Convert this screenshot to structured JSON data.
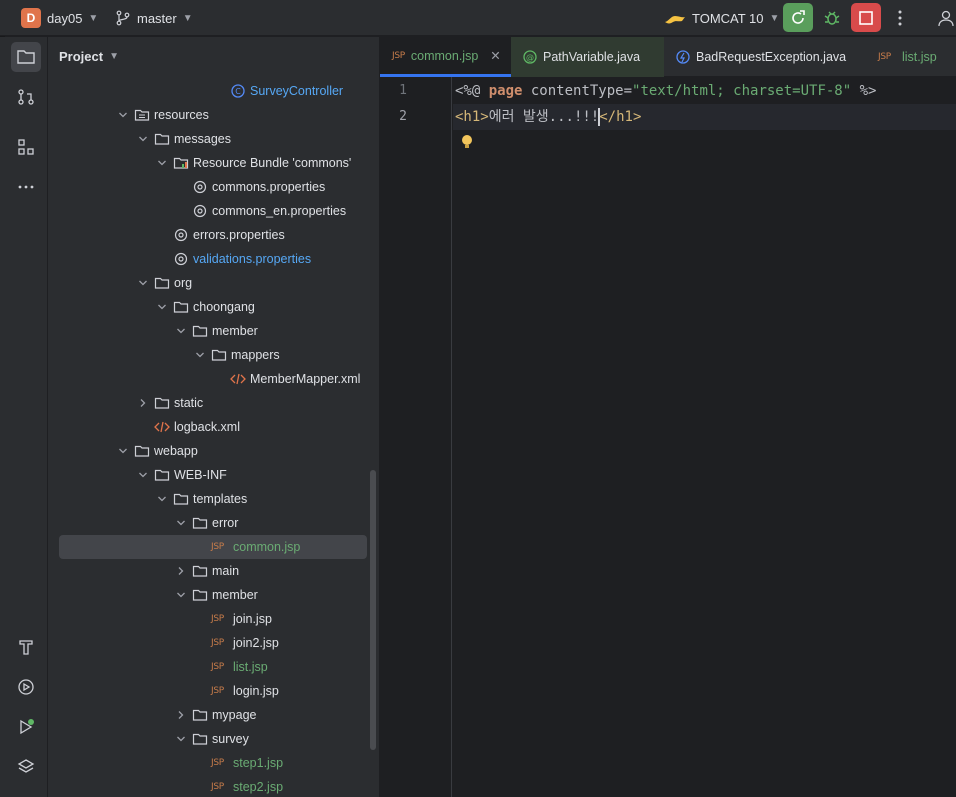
{
  "titlebar": {
    "project_initial": "D",
    "project_name": "day05",
    "branch": "master",
    "run_config": "TOMCAT 10"
  },
  "project_panel": {
    "title": "Project",
    "tree": [
      {
        "label": "SurveyController",
        "kind": "class",
        "color": "#56a8f5"
      },
      {
        "label": "resources",
        "kind": "folder-res"
      },
      {
        "label": "messages",
        "kind": "folder"
      },
      {
        "label": "Resource Bundle 'commons'",
        "kind": "bundle"
      },
      {
        "label": "commons.properties",
        "kind": "props"
      },
      {
        "label": "commons_en.properties",
        "kind": "props"
      },
      {
        "label": "errors.properties",
        "kind": "props"
      },
      {
        "label": "validations.properties",
        "kind": "props",
        "color": "#56a8f5"
      },
      {
        "label": "org",
        "kind": "folder"
      },
      {
        "label": "choongang",
        "kind": "folder"
      },
      {
        "label": "member",
        "kind": "folder"
      },
      {
        "label": "mappers",
        "kind": "folder"
      },
      {
        "label": "MemberMapper.xml",
        "kind": "xml"
      },
      {
        "label": "static",
        "kind": "folder"
      },
      {
        "label": "logback.xml",
        "kind": "xml"
      },
      {
        "label": "webapp",
        "kind": "folder"
      },
      {
        "label": "WEB-INF",
        "kind": "folder"
      },
      {
        "label": "templates",
        "kind": "folder"
      },
      {
        "label": "error",
        "kind": "folder"
      },
      {
        "label": "common.jsp",
        "kind": "jsp",
        "color": "#6aab73",
        "selected": true
      },
      {
        "label": "main",
        "kind": "folder"
      },
      {
        "label": "member",
        "kind": "folder"
      },
      {
        "label": "join.jsp",
        "kind": "jsp"
      },
      {
        "label": "join2.jsp",
        "kind": "jsp"
      },
      {
        "label": "list.jsp",
        "kind": "jsp",
        "color": "#6aab73"
      },
      {
        "label": "login.jsp",
        "kind": "jsp"
      },
      {
        "label": "mypage",
        "kind": "folder"
      },
      {
        "label": "survey",
        "kind": "folder"
      },
      {
        "label": "step1.jsp",
        "kind": "jsp",
        "color": "#6aab73"
      },
      {
        "label": "step2.jsp",
        "kind": "jsp",
        "color": "#6aab73"
      }
    ]
  },
  "tabs": [
    {
      "label": "common.jsp",
      "icon": "jsp-icon",
      "color": "#6aab73",
      "active": true
    },
    {
      "label": "PathVariable.java",
      "icon": "annotation-icon",
      "color": "#dfe1e5"
    },
    {
      "label": "BadRequestException.java",
      "icon": "exception-class-icon",
      "color": "#dfe1e5"
    },
    {
      "label": "list.jsp",
      "icon": "jsp-icon",
      "color": "#6aab73"
    }
  ],
  "editor": {
    "line_numbers": [
      "1",
      "2"
    ],
    "line1": {
      "open": "<%@ ",
      "kw": "page",
      "attr": " contentType=",
      "value": "\"text/html; charset=UTF-8\"",
      "close": " %>"
    },
    "line2": {
      "open_tag": "<h1>",
      "text": "에러 발생...!!!",
      "close_tag": "</h1>"
    }
  }
}
